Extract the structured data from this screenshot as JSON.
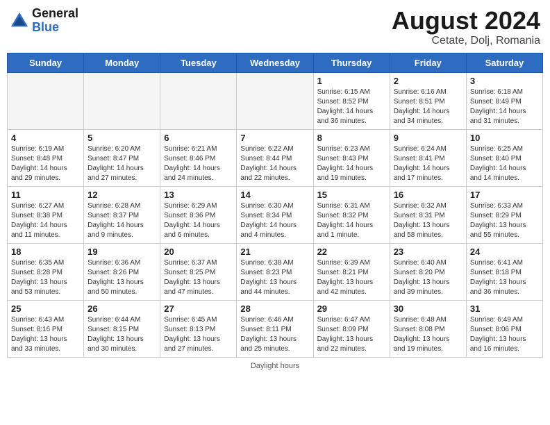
{
  "header": {
    "logo_line1": "General",
    "logo_line2": "Blue",
    "month_title": "August 2024",
    "location": "Cetate, Dolj, Romania"
  },
  "days_of_week": [
    "Sunday",
    "Monday",
    "Tuesday",
    "Wednesday",
    "Thursday",
    "Friday",
    "Saturday"
  ],
  "weeks": [
    [
      {
        "day": "",
        "info": ""
      },
      {
        "day": "",
        "info": ""
      },
      {
        "day": "",
        "info": ""
      },
      {
        "day": "",
        "info": ""
      },
      {
        "day": "1",
        "info": "Sunrise: 6:15 AM\nSunset: 8:52 PM\nDaylight: 14 hours and 36 minutes."
      },
      {
        "day": "2",
        "info": "Sunrise: 6:16 AM\nSunset: 8:51 PM\nDaylight: 14 hours and 34 minutes."
      },
      {
        "day": "3",
        "info": "Sunrise: 6:18 AM\nSunset: 8:49 PM\nDaylight: 14 hours and 31 minutes."
      }
    ],
    [
      {
        "day": "4",
        "info": "Sunrise: 6:19 AM\nSunset: 8:48 PM\nDaylight: 14 hours and 29 minutes."
      },
      {
        "day": "5",
        "info": "Sunrise: 6:20 AM\nSunset: 8:47 PM\nDaylight: 14 hours and 27 minutes."
      },
      {
        "day": "6",
        "info": "Sunrise: 6:21 AM\nSunset: 8:46 PM\nDaylight: 14 hours and 24 minutes."
      },
      {
        "day": "7",
        "info": "Sunrise: 6:22 AM\nSunset: 8:44 PM\nDaylight: 14 hours and 22 minutes."
      },
      {
        "day": "8",
        "info": "Sunrise: 6:23 AM\nSunset: 8:43 PM\nDaylight: 14 hours and 19 minutes."
      },
      {
        "day": "9",
        "info": "Sunrise: 6:24 AM\nSunset: 8:41 PM\nDaylight: 14 hours and 17 minutes."
      },
      {
        "day": "10",
        "info": "Sunrise: 6:25 AM\nSunset: 8:40 PM\nDaylight: 14 hours and 14 minutes."
      }
    ],
    [
      {
        "day": "11",
        "info": "Sunrise: 6:27 AM\nSunset: 8:38 PM\nDaylight: 14 hours and 11 minutes."
      },
      {
        "day": "12",
        "info": "Sunrise: 6:28 AM\nSunset: 8:37 PM\nDaylight: 14 hours and 9 minutes."
      },
      {
        "day": "13",
        "info": "Sunrise: 6:29 AM\nSunset: 8:36 PM\nDaylight: 14 hours and 6 minutes."
      },
      {
        "day": "14",
        "info": "Sunrise: 6:30 AM\nSunset: 8:34 PM\nDaylight: 14 hours and 4 minutes."
      },
      {
        "day": "15",
        "info": "Sunrise: 6:31 AM\nSunset: 8:32 PM\nDaylight: 14 hours and 1 minute."
      },
      {
        "day": "16",
        "info": "Sunrise: 6:32 AM\nSunset: 8:31 PM\nDaylight: 13 hours and 58 minutes."
      },
      {
        "day": "17",
        "info": "Sunrise: 6:33 AM\nSunset: 8:29 PM\nDaylight: 13 hours and 55 minutes."
      }
    ],
    [
      {
        "day": "18",
        "info": "Sunrise: 6:35 AM\nSunset: 8:28 PM\nDaylight: 13 hours and 53 minutes."
      },
      {
        "day": "19",
        "info": "Sunrise: 6:36 AM\nSunset: 8:26 PM\nDaylight: 13 hours and 50 minutes."
      },
      {
        "day": "20",
        "info": "Sunrise: 6:37 AM\nSunset: 8:25 PM\nDaylight: 13 hours and 47 minutes."
      },
      {
        "day": "21",
        "info": "Sunrise: 6:38 AM\nSunset: 8:23 PM\nDaylight: 13 hours and 44 minutes."
      },
      {
        "day": "22",
        "info": "Sunrise: 6:39 AM\nSunset: 8:21 PM\nDaylight: 13 hours and 42 minutes."
      },
      {
        "day": "23",
        "info": "Sunrise: 6:40 AM\nSunset: 8:20 PM\nDaylight: 13 hours and 39 minutes."
      },
      {
        "day": "24",
        "info": "Sunrise: 6:41 AM\nSunset: 8:18 PM\nDaylight: 13 hours and 36 minutes."
      }
    ],
    [
      {
        "day": "25",
        "info": "Sunrise: 6:43 AM\nSunset: 8:16 PM\nDaylight: 13 hours and 33 minutes."
      },
      {
        "day": "26",
        "info": "Sunrise: 6:44 AM\nSunset: 8:15 PM\nDaylight: 13 hours and 30 minutes."
      },
      {
        "day": "27",
        "info": "Sunrise: 6:45 AM\nSunset: 8:13 PM\nDaylight: 13 hours and 27 minutes."
      },
      {
        "day": "28",
        "info": "Sunrise: 6:46 AM\nSunset: 8:11 PM\nDaylight: 13 hours and 25 minutes."
      },
      {
        "day": "29",
        "info": "Sunrise: 6:47 AM\nSunset: 8:09 PM\nDaylight: 13 hours and 22 minutes."
      },
      {
        "day": "30",
        "info": "Sunrise: 6:48 AM\nSunset: 8:08 PM\nDaylight: 13 hours and 19 minutes."
      },
      {
        "day": "31",
        "info": "Sunrise: 6:49 AM\nSunset: 8:06 PM\nDaylight: 13 hours and 16 minutes."
      }
    ]
  ],
  "footer": {
    "note": "Daylight hours"
  }
}
